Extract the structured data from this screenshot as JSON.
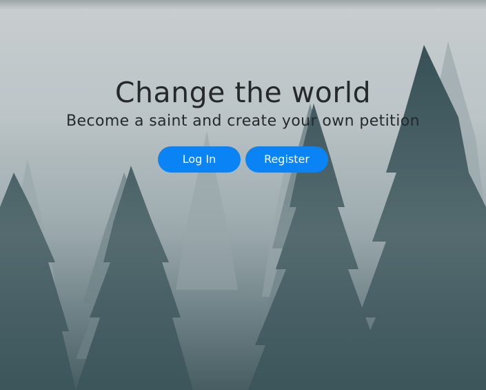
{
  "hero": {
    "headline": "Change the world",
    "subheadline": "Become a saint and create your own petition",
    "background_image": "misty pine forest"
  },
  "actions": {
    "login_label": "Log In",
    "register_label": "Register"
  },
  "colors": {
    "button_bg": "#0a84f5",
    "button_text": "#ffffff",
    "headline_text": "#26292b"
  }
}
